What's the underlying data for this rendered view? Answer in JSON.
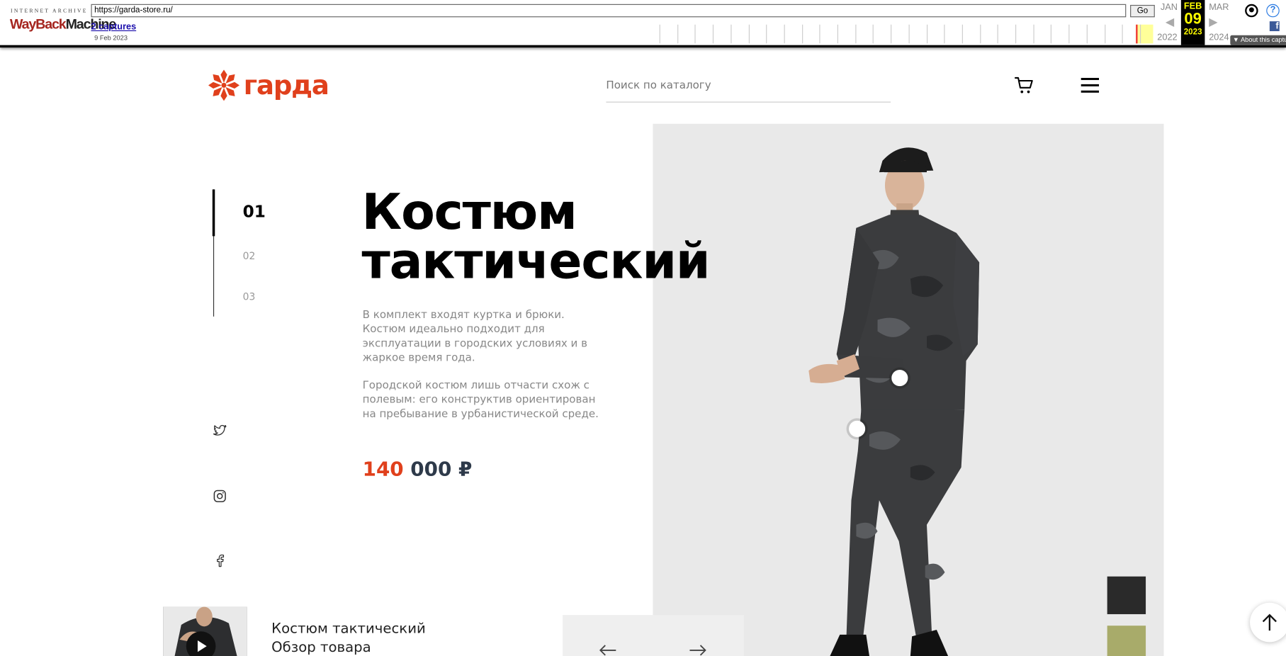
{
  "wayback": {
    "logo_top": "INTERNET ARCHIVE",
    "logo_main_a": "WayBack",
    "logo_main_b": "Machine",
    "url": "https://garda-store.ru/",
    "go_label": "Go",
    "captures_label": "2 captures",
    "capture_date": "9 Feb 2023",
    "prev_month": "JAN",
    "cur_month": "FEB",
    "next_month": "MAR",
    "cur_day": "09",
    "prev_year": "2022",
    "cur_year": "2023",
    "next_year": "2024",
    "about_label": "About this capture",
    "help_label": "?",
    "fb_label": "f"
  },
  "header": {
    "logo_text": "гарда",
    "search_placeholder": "Поиск по каталогу"
  },
  "pager": [
    "01",
    "02",
    "03"
  ],
  "hero": {
    "title_line1": "Костюм",
    "title_line2": "тактический",
    "desc1": "В комплект входят куртка и брюки. Костюм идеально подходит для эксплуатации в городских условиях и в жаркое время года.",
    "desc2": "Городской костюм лишь отчасти схож с полевым: его конструктив ориентирован на пребывание в урбанистической среде.",
    "price_part1": "140",
    "price_part2": "000 ₽"
  },
  "video": {
    "title_line1": "Костюм тактический",
    "title_line2": "Обзор товара"
  },
  "colors": {
    "accent": "#e0401c",
    "price_dark": "#2e3a4a",
    "photo_bg": "#e9e9e9"
  },
  "icons": [
    "twitter-icon",
    "instagram-icon",
    "facebook-icon",
    "cart-icon",
    "menu-icon",
    "arrow-left-icon",
    "arrow-right-icon",
    "arrow-up-icon",
    "play-icon"
  ]
}
